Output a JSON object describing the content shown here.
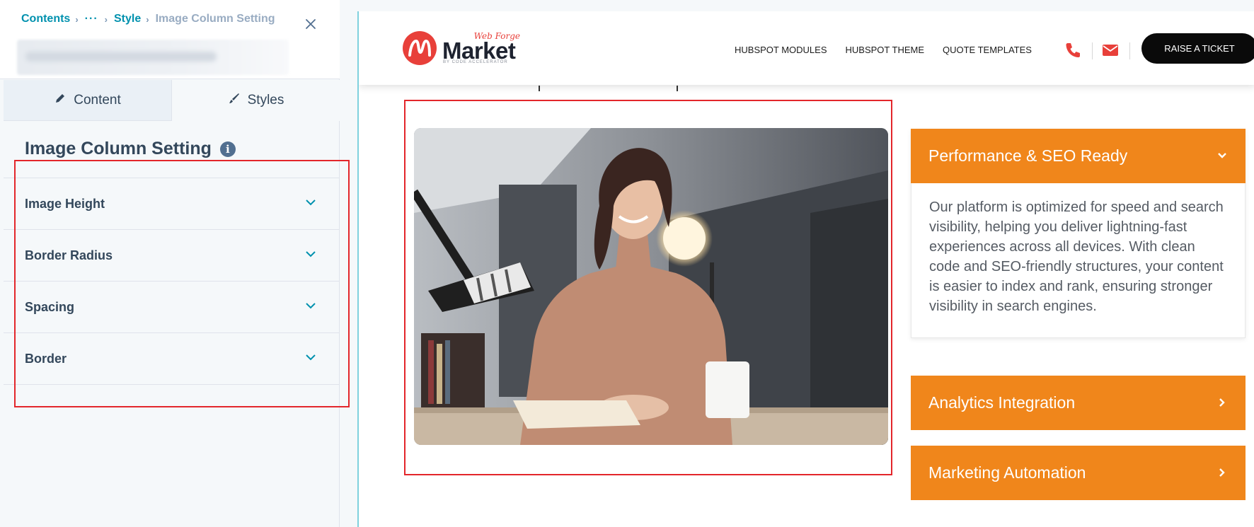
{
  "panel": {
    "breadcrumb": {
      "contents": "Contents",
      "ellipsis": "···",
      "style": "Style",
      "current": "Image Column Setting"
    },
    "tabs": [
      {
        "label": "Content",
        "icon": "pencil-icon"
      },
      {
        "label": "Styles",
        "icon": "brush-icon"
      }
    ],
    "section_title": "Image Column Setting",
    "info_icon_glyph": "i",
    "accordion": [
      {
        "label": "Image Height"
      },
      {
        "label": "Border Radius"
      },
      {
        "label": "Spacing"
      },
      {
        "label": "Border"
      }
    ],
    "highlight_color": "#e3262b",
    "accent_color": "#0091ae"
  },
  "site": {
    "logo": {
      "small": "Web Forge",
      "big": "Market",
      "tag": "BY CODE ACCELERATOR"
    },
    "nav": [
      "HUBSPOT MODULES",
      "HUBSPOT THEME",
      "QUOTE TEMPLATES"
    ],
    "icons": [
      "phone-icon",
      "mail-icon"
    ],
    "ticket_button": "RAISE A TICKET",
    "accordion": [
      {
        "title": "Performance & SEO Ready",
        "expanded": true,
        "body": "Our platform is optimized for speed and search visibility, helping you deliver lightning-fast experiences across all devices. With clean code and SEO-friendly structures, your content is easier to index and rank, ensuring stronger visibility in search engines."
      },
      {
        "title": "Analytics Integration",
        "expanded": false
      },
      {
        "title": "Marketing Automation",
        "expanded": false
      }
    ],
    "brand_orange": "#f0861b",
    "brand_red": "#e8403a"
  }
}
